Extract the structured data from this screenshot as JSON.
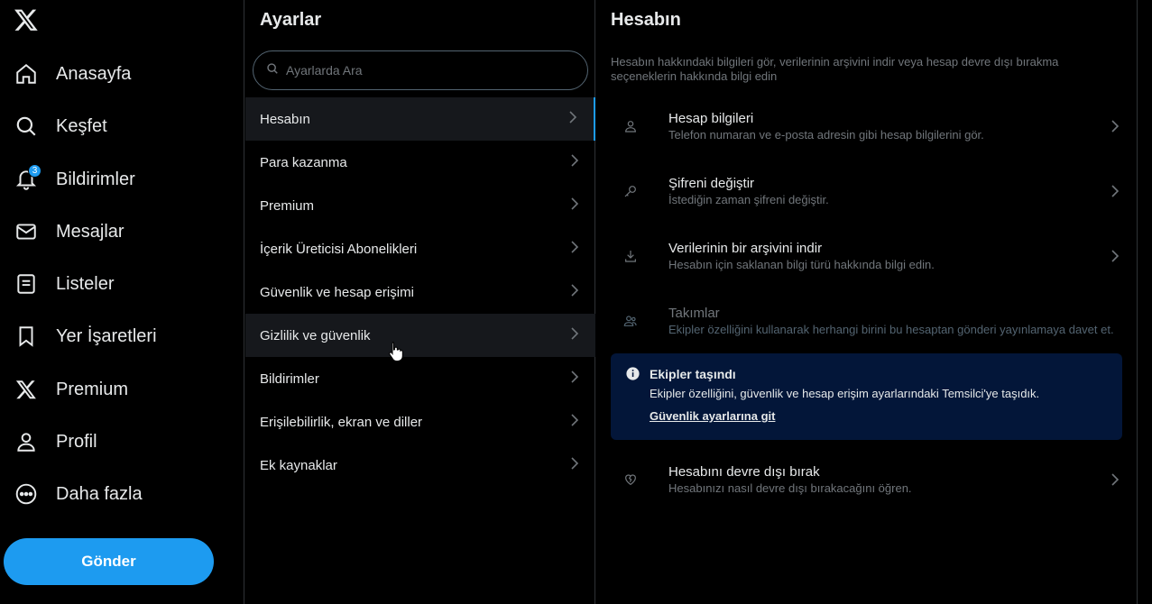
{
  "nav": {
    "items": [
      {
        "label": "Anasayfa",
        "icon": "home-icon"
      },
      {
        "label": "Keşfet",
        "icon": "search-icon"
      },
      {
        "label": "Bildirimler",
        "icon": "bell-icon",
        "badge": "3"
      },
      {
        "label": "Mesajlar",
        "icon": "mail-icon"
      },
      {
        "label": "Listeler",
        "icon": "list-icon"
      },
      {
        "label": "Yer İşaretleri",
        "icon": "bookmark-icon"
      },
      {
        "label": "Premium",
        "icon": "x-logo-icon"
      },
      {
        "label": "Profil",
        "icon": "person-icon"
      },
      {
        "label": "Daha fazla",
        "icon": "more-icon"
      }
    ],
    "post_label": "Gönder"
  },
  "settings": {
    "title": "Ayarlar",
    "search_placeholder": "Ayarlarda Ara",
    "items": [
      {
        "label": "Hesabın"
      },
      {
        "label": "Para kazanma"
      },
      {
        "label": "Premium"
      },
      {
        "label": "İçerik Üreticisi Abonelikleri"
      },
      {
        "label": "Güvenlik ve hesap erişimi"
      },
      {
        "label": "Gizlilik ve güvenlik"
      },
      {
        "label": "Bildirimler"
      },
      {
        "label": "Erişilebilirlik, ekran ve diller"
      },
      {
        "label": "Ek kaynaklar"
      }
    ]
  },
  "detail": {
    "title": "Hesabın",
    "description": "Hesabın hakkındaki bilgileri gör, verilerinin arşivini indir veya hesap devre dışı bırakma seçeneklerin hakkında bilgi edin",
    "options": [
      {
        "title": "Hesap bilgileri",
        "subtitle": "Telefon numaran ve e-posta adresin gibi hesap bilgilerini gör.",
        "icon": "person-icon"
      },
      {
        "title": "Şifreni değiştir",
        "subtitle": "İstediğin zaman şifreni değiştir.",
        "icon": "key-icon"
      },
      {
        "title": "Verilerinin bir arşivini indir",
        "subtitle": "Hesabın için saklanan bilgi türü hakkında bilgi edin.",
        "icon": "download-icon"
      },
      {
        "title": "Takımlar",
        "subtitle": "Ekipler özelliğini kullanarak herhangi birini bu hesaptan gönderi yayınlamaya davet et.",
        "icon": "team-icon"
      }
    ],
    "notice": {
      "title": "Ekipler taşındı",
      "body": "Ekipler özelliğini, güvenlik ve hesap erişim ayarlarındaki Temsilci'ye taşıdık.",
      "link": "Güvenlik ayarlarına git"
    },
    "deactivate": {
      "title": "Hesabını devre dışı bırak",
      "subtitle": "Hesabınızı nasıl devre dışı bırakacağını öğren.",
      "icon": "broken-heart-icon"
    }
  },
  "colors": {
    "accent": "#1d9bf0",
    "notice_bg": "#031639"
  }
}
